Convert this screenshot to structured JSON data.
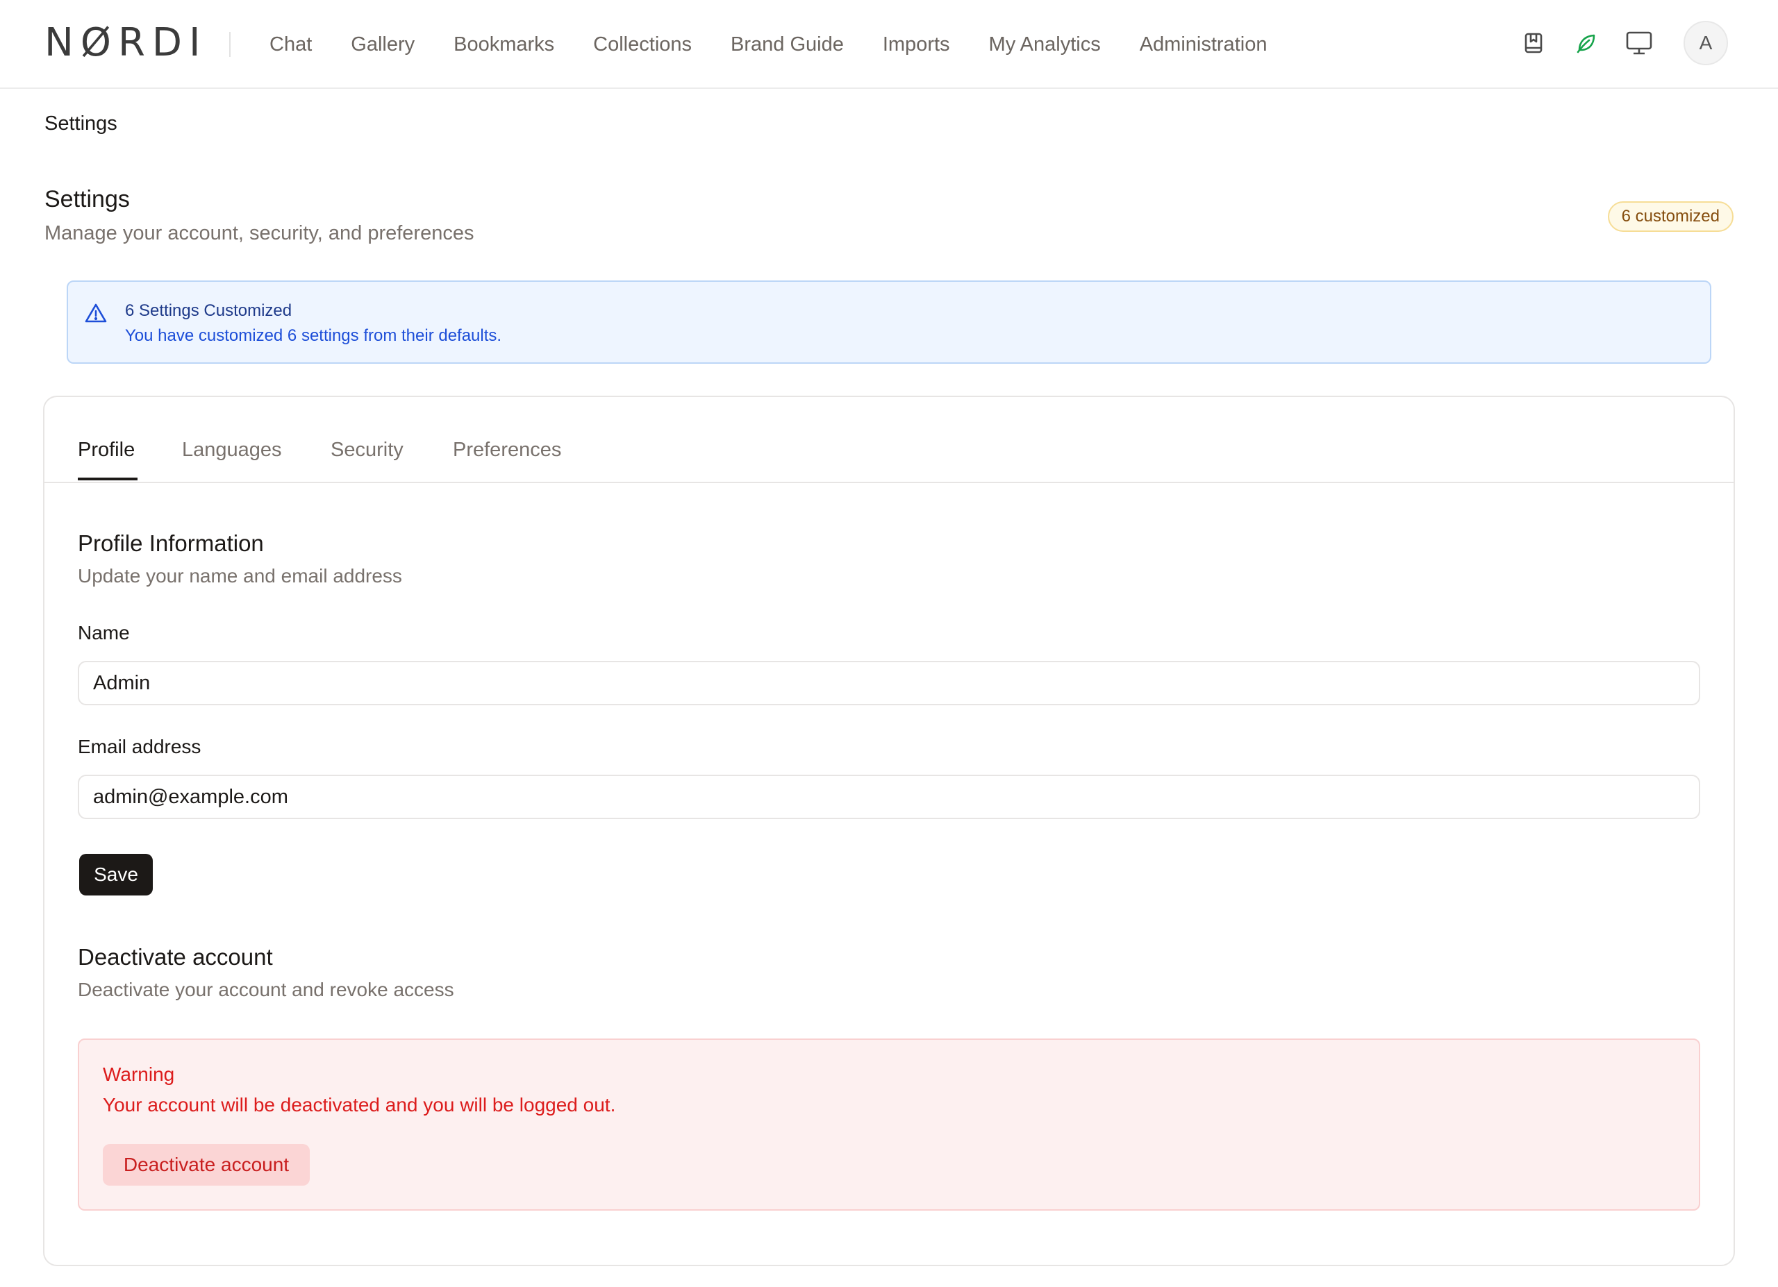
{
  "app": {
    "logo": "NØRDI"
  },
  "nav": {
    "items": [
      {
        "label": "Chat"
      },
      {
        "label": "Gallery"
      },
      {
        "label": "Bookmarks"
      },
      {
        "label": "Collections"
      },
      {
        "label": "Brand Guide"
      },
      {
        "label": "Imports"
      },
      {
        "label": "My Analytics"
      },
      {
        "label": "Administration"
      }
    ]
  },
  "header_icons": {
    "bookmark_icon": "bookmark-icon",
    "leaf_icon": "leaf-icon",
    "monitor_icon": "monitor-icon",
    "leaf_color": "#16a34a",
    "avatar_initial": "A"
  },
  "breadcrumb": "Settings",
  "page": {
    "title": "Settings",
    "subtitle": "Manage your account, security, and preferences",
    "badge": "6 customized"
  },
  "info_alert": {
    "icon": "warning-triangle-icon",
    "title": "6 Settings Customized",
    "text": "You have customized 6 settings from their defaults."
  },
  "tabs": [
    {
      "label": "Profile",
      "active": true
    },
    {
      "label": "Languages",
      "active": false
    },
    {
      "label": "Security",
      "active": false
    },
    {
      "label": "Preferences",
      "active": false
    }
  ],
  "profile": {
    "title": "Profile Information",
    "subtitle": "Update your name and email address",
    "name_label": "Name",
    "name_value": "Admin",
    "email_label": "Email address",
    "email_value": "admin@example.com",
    "save_label": "Save"
  },
  "deactivate": {
    "title": "Deactivate account",
    "subtitle": "Deactivate your account and revoke access",
    "warning_title": "Warning",
    "warning_text": "Your account will be deactivated and you will be logged out.",
    "button_label": "Deactivate account",
    "danger_color": "#dc1c1c"
  }
}
